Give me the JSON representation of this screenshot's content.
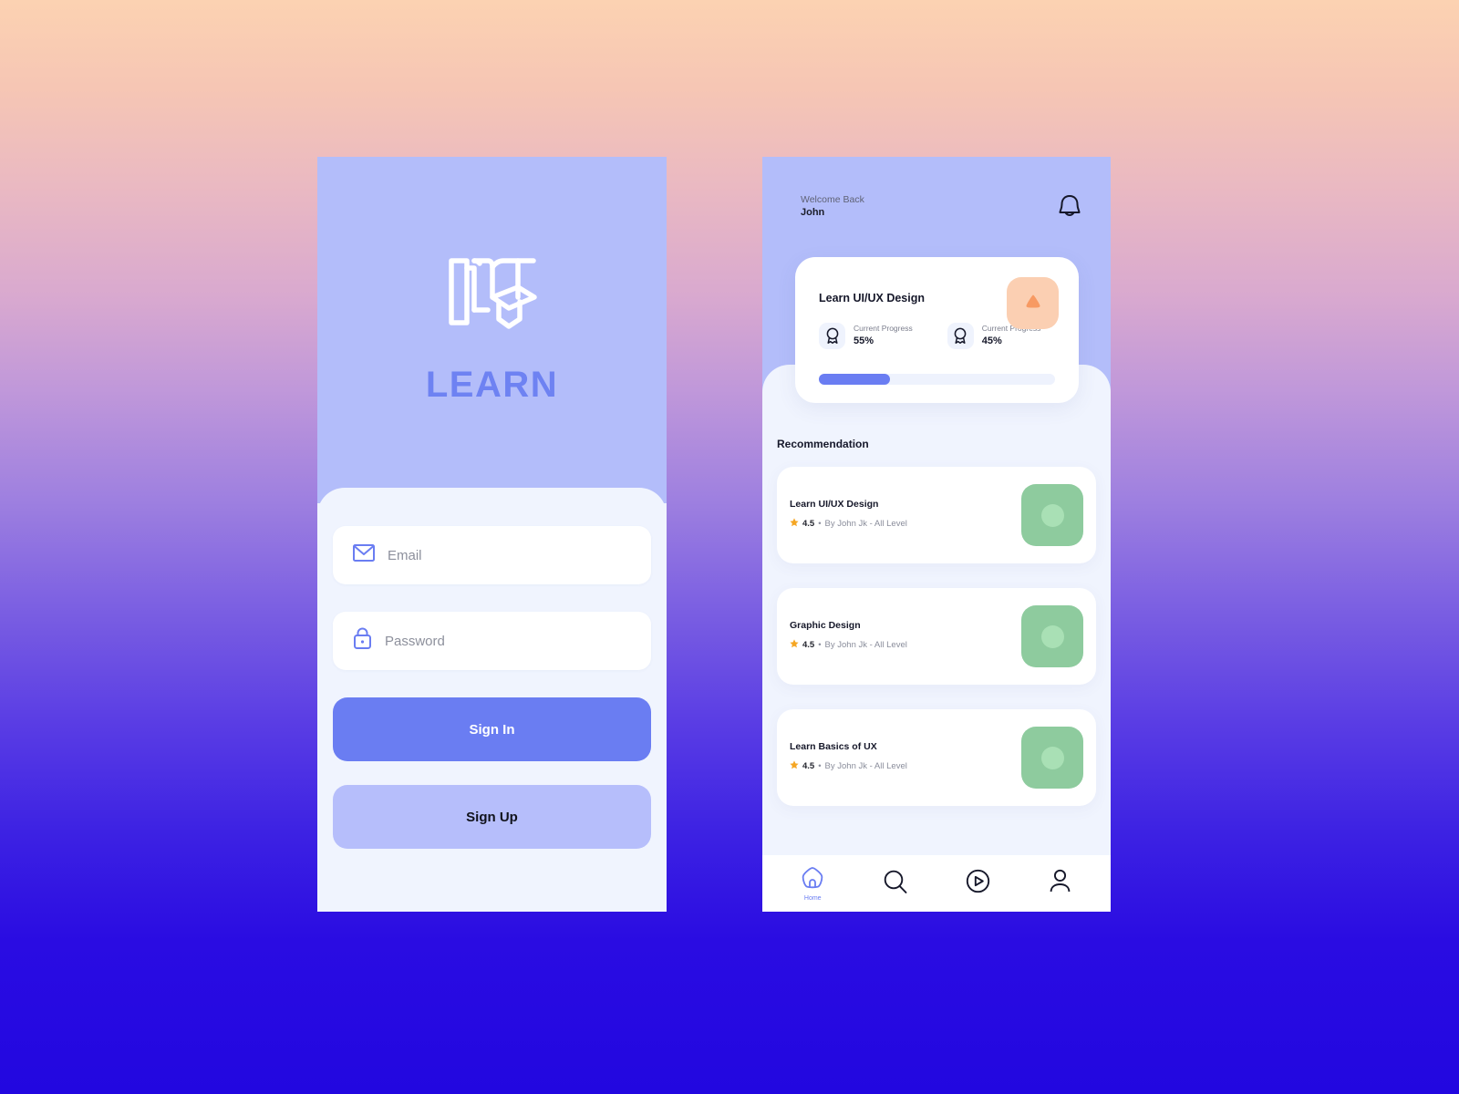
{
  "login": {
    "brand": "LEARN",
    "logo_icon": "book-graduation-cap-icon",
    "email": {
      "placeholder": "Email",
      "value": "",
      "icon": "envelope-icon"
    },
    "password": {
      "placeholder": "Password",
      "value": "",
      "icon": "lock-icon"
    },
    "sign_in_label": "Sign In",
    "sign_up_label": "Sign Up"
  },
  "home": {
    "welcome_greeting": "Welcome Back",
    "user_name": "John",
    "bell_icon": "bell-icon",
    "progress_card": {
      "title": "Learn UI/UX Design",
      "thumb_icon": "triangle-drop-icon",
      "stats": [
        {
          "icon": "award-badge-icon",
          "label": "Current Progress",
          "value": "55%"
        },
        {
          "icon": "award-badge-icon",
          "label": "Current Progress",
          "value": "45%"
        }
      ],
      "progress_percent": 30
    },
    "recommendation_heading": "Recommendation",
    "recommendations": [
      {
        "title": "Learn UI/UX Design",
        "rating": "4.5",
        "separator": "•",
        "byline": "By John Jk - All Level",
        "star_icon": "star-icon",
        "thumb_icon": "course-thumbnail"
      },
      {
        "title": "Graphic Design",
        "rating": "4.5",
        "separator": "•",
        "byline": "By John Jk - All Level",
        "star_icon": "star-icon",
        "thumb_icon": "course-thumbnail"
      },
      {
        "title": "Learn Basics of UX",
        "rating": "4.5",
        "separator": "•",
        "byline": "By John Jk - All Level",
        "star_icon": "star-icon",
        "thumb_icon": "course-thumbnail"
      }
    ],
    "nav": [
      {
        "icon": "home-icon",
        "label": "Home",
        "active": true
      },
      {
        "icon": "search-icon",
        "label": "",
        "active": false
      },
      {
        "icon": "play-circle-icon",
        "label": "",
        "active": false
      },
      {
        "icon": "user-icon",
        "label": "",
        "active": false
      }
    ]
  },
  "colors": {
    "accent_blue": "#6a7df2",
    "panel_lavender": "#b3bdfa",
    "sheet": "#f0f4fe",
    "thumb_green": "#8ecb9e",
    "thumb_peach": "#fbcfb2",
    "star_orange": "#f5a623"
  }
}
